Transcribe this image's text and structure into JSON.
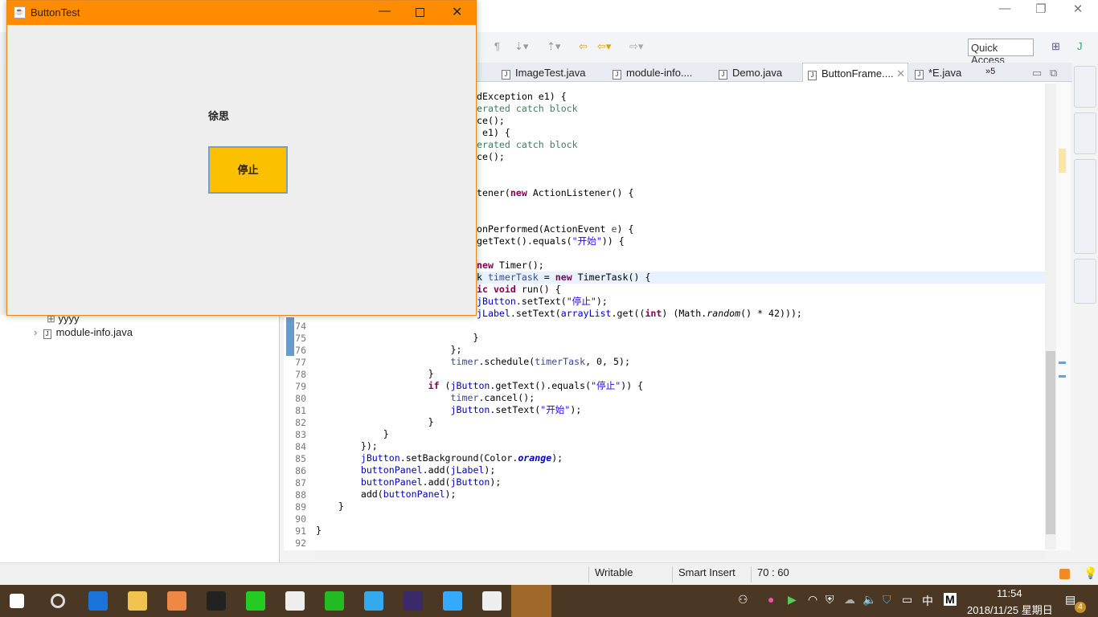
{
  "ide": {
    "toolbar": {
      "quick_access": "Quick Access"
    },
    "tabs": [
      {
        "label": "ImageTest.java"
      },
      {
        "label": "module-info...."
      },
      {
        "label": "Demo.java"
      },
      {
        "label": "ButtonFrame....",
        "active": true
      },
      {
        "label": "*E.java"
      },
      {
        "label": "»5"
      }
    ],
    "package_explorer": {
      "items": [
        {
          "label": "yyyy",
          "icon": "package-icon"
        },
        {
          "label": "module-info.java",
          "icon": "java-file-icon"
        }
      ]
    },
    "status": {
      "mode": "Writable",
      "insert": "Smart Insert",
      "position": "70 : 60"
    },
    "code_fragments": [
      {
        "tokens": [
          [
            "p",
            "dException e1) {"
          ]
        ]
      },
      {
        "tokens": [
          [
            "c",
            "erated catch block"
          ]
        ]
      },
      {
        "tokens": [
          [
            "p",
            "ce();"
          ]
        ]
      },
      {
        "tokens": [
          [
            "p",
            " e1) {"
          ]
        ]
      },
      {
        "tokens": [
          [
            "c",
            "erated catch block"
          ]
        ]
      },
      {
        "tokens": [
          [
            "p",
            "ce();"
          ]
        ]
      },
      {
        "tokens": []
      },
      {
        "tokens": []
      },
      {
        "tokens": [
          [
            "p",
            "tener("
          ],
          [
            "k",
            "new"
          ],
          [
            "p",
            " ActionListener() {"
          ]
        ]
      },
      {
        "tokens": []
      },
      {
        "tokens": []
      },
      {
        "tokens": [
          [
            "p",
            "onPerformed(ActionEvent "
          ],
          [
            "v",
            "e"
          ],
          [
            "p",
            ") {"
          ]
        ]
      },
      {
        "tokens": [
          [
            "p",
            "getText().equals("
          ],
          [
            "s",
            "\"开始\""
          ],
          [
            "p",
            ")) {"
          ]
        ]
      },
      {
        "tokens": []
      },
      {
        "tokens": [
          [
            "k",
            "new"
          ],
          [
            "p",
            " Timer();"
          ]
        ]
      },
      {
        "tokens": [
          [
            "p",
            "k "
          ],
          [
            "v",
            "timerTask"
          ],
          [
            "p",
            " = "
          ],
          [
            "k",
            "new"
          ],
          [
            "p",
            " TimerTask() {"
          ]
        ]
      },
      {
        "tokens": [
          [
            "k",
            "ic void"
          ],
          [
            "p",
            " run() {"
          ]
        ]
      },
      {
        "tokens": [
          [
            "f",
            "jButton"
          ],
          [
            "p",
            ".setText("
          ],
          [
            "s",
            "\"停止\""
          ],
          [
            "p",
            ");"
          ]
        ]
      },
      {
        "tokens": [
          [
            "f",
            "jLabel"
          ],
          [
            "p",
            ".setText("
          ],
          [
            "f",
            "arrayList"
          ],
          [
            "p",
            ".get(("
          ],
          [
            "k",
            "int"
          ],
          [
            "p",
            ") (Math."
          ],
          [
            "i",
            "random"
          ],
          [
            "p",
            "() * 42)));"
          ]
        ]
      }
    ],
    "code_lines": [
      {
        "n": "74",
        "tokens": []
      },
      {
        "n": "75",
        "tokens": [
          [
            "p",
            "            }"
          ]
        ]
      },
      {
        "n": "76",
        "tokens": [
          [
            "p",
            "        };"
          ]
        ]
      },
      {
        "n": "77",
        "tokens": [
          [
            "p",
            "        "
          ],
          [
            "v",
            "timer"
          ],
          [
            "p",
            ".schedule("
          ],
          [
            "v",
            "timerTask"
          ],
          [
            "p",
            ", 0, 5);"
          ]
        ]
      },
      {
        "n": "78",
        "tokens": [
          [
            "p",
            "    }"
          ]
        ]
      },
      {
        "n": "79",
        "tokens": [
          [
            "p",
            "    "
          ],
          [
            "k",
            "if"
          ],
          [
            "p",
            " ("
          ],
          [
            "f",
            "jButton"
          ],
          [
            "p",
            ".getText().equals("
          ],
          [
            "s",
            "\"停止\""
          ],
          [
            "p",
            ")) {"
          ]
        ]
      },
      {
        "n": "80",
        "tokens": [
          [
            "p",
            "        "
          ],
          [
            "v",
            "timer"
          ],
          [
            "p",
            ".cancel();"
          ]
        ]
      },
      {
        "n": "81",
        "tokens": [
          [
            "p",
            "        "
          ],
          [
            "f",
            "jButton"
          ],
          [
            "p",
            ".setText("
          ],
          [
            "s",
            "\"开始\""
          ],
          [
            "p",
            ");"
          ]
        ]
      },
      {
        "n": "82",
        "tokens": [
          [
            "p",
            "    }"
          ]
        ]
      },
      {
        "n": "83",
        "tokens": [
          [
            "p",
            "}"
          ]
        ]
      },
      {
        "n": "84",
        "tokens": [
          [
            "p",
            "});"
          ]
        ]
      },
      {
        "n": "85",
        "tokens": [
          [
            "f",
            "jButton"
          ],
          [
            "p",
            ".setBackground(Color."
          ],
          [
            "fi",
            "orange"
          ],
          [
            "p",
            ");"
          ]
        ]
      },
      {
        "n": "86",
        "tokens": [
          [
            "f",
            "buttonPanel"
          ],
          [
            "p",
            ".add("
          ],
          [
            "f",
            "jLabel"
          ],
          [
            "p",
            ");"
          ]
        ]
      },
      {
        "n": "87",
        "tokens": [
          [
            "f",
            "buttonPanel"
          ],
          [
            "p",
            ".add("
          ],
          [
            "f",
            "jButton"
          ],
          [
            "p",
            ");"
          ]
        ]
      },
      {
        "n": "88",
        "tokens": [
          [
            "p",
            "add("
          ],
          [
            "f",
            "buttonPanel"
          ],
          [
            "p",
            ");"
          ]
        ]
      },
      {
        "n": "89",
        "tokens": [
          [
            "p",
            "}"
          ]
        ]
      },
      {
        "n": "90",
        "tokens": []
      },
      {
        "n": "91",
        "tokens": [
          [
            "p",
            "}"
          ]
        ]
      },
      {
        "n": "92",
        "tokens": []
      }
    ]
  },
  "java_window": {
    "title": "ButtonTest",
    "label": "徐思",
    "button": "停止",
    "button_color": "#fbc000",
    "title_color": "#ff8c00"
  },
  "taskbar": {
    "time": "11:54",
    "date": "2018/11/25 星期日",
    "ime": "中",
    "notifications": "4",
    "apps": [
      "start",
      "cortana",
      "edge",
      "file-explorer",
      "store",
      "qq",
      "green-app",
      "mail",
      "iqiyi",
      "video-player",
      "eclipse",
      "internet-explorer",
      "java",
      "java-active"
    ]
  }
}
